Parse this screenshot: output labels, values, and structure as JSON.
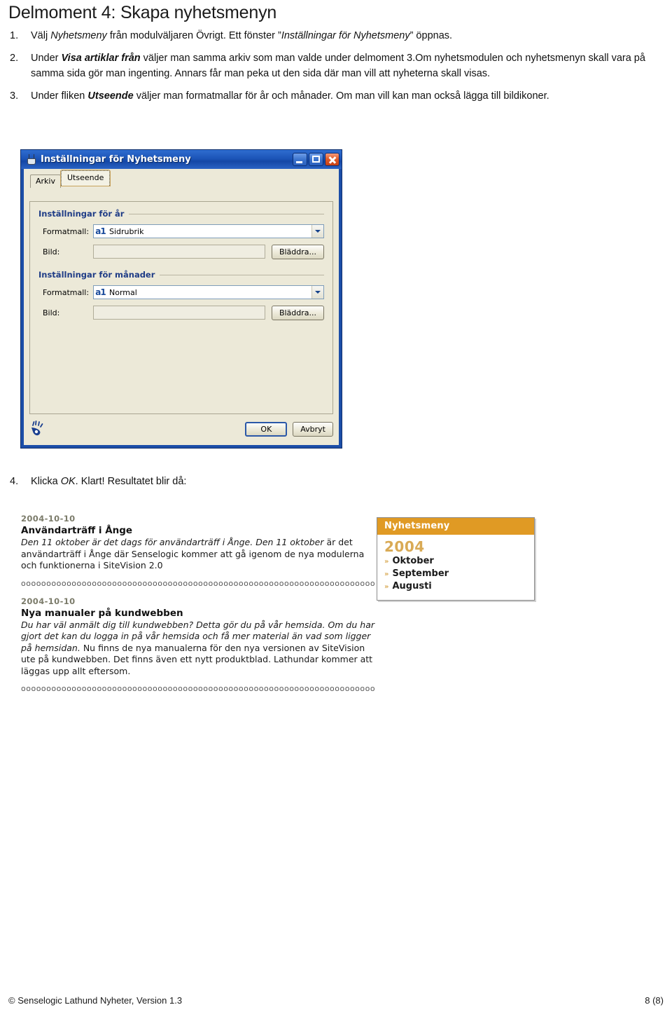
{
  "document": {
    "title": "Delmoment 4: Skapa nyhetsmenyn",
    "steps": [
      {
        "num": "1.",
        "parts": [
          {
            "t": "Välj ",
            "style": "normal"
          },
          {
            "t": "Nyhetsmeny",
            "style": "italic"
          },
          {
            "t": " från modulväljaren Övrigt. Ett fönster ”",
            "style": "normal"
          },
          {
            "t": "Inställningar för Nyhetsmeny",
            "style": "italic"
          },
          {
            "t": "” öppnas.",
            "style": "normal"
          }
        ]
      },
      {
        "num": "2.",
        "parts": [
          {
            "t": "Under ",
            "style": "normal"
          },
          {
            "t": "Visa artiklar från",
            "style": "italic-bold"
          },
          {
            "t": " väljer man samma arkiv som man valde under delmoment 3.Om nyhetsmodulen och nyhetsmenyn skall vara på samma sida gör man ingenting. Annars får man peka ut den sida där man vill att nyheterna skall visas.",
            "style": "normal"
          }
        ]
      },
      {
        "num": "3.",
        "parts": [
          {
            "t": "Under fliken ",
            "style": "normal"
          },
          {
            "t": "Utseende",
            "style": "italic-bold"
          },
          {
            "t": " väljer man formatmallar för år och månader. Om man vill kan man också lägga till bildikoner.",
            "style": "normal"
          }
        ]
      },
      {
        "num": "4.",
        "parts": [
          {
            "t": "Klicka ",
            "style": "normal"
          },
          {
            "t": "OK",
            "style": "italic"
          },
          {
            "t": ". Klart! Resultatet blir då:",
            "style": "normal"
          }
        ]
      }
    ]
  },
  "dialog": {
    "title": "Inställningar för Nyhetsmeny",
    "app_icon": "coffee-cup-icon",
    "window_buttons": {
      "minimize": "minimize-icon",
      "maximize": "maximize-icon",
      "close": "close-icon"
    },
    "tabs": [
      {
        "label": "Arkiv",
        "active": false
      },
      {
        "label": "Utseende",
        "active": true
      }
    ],
    "groups": [
      {
        "title": "Inställningar för år",
        "formatmall_label": "Formatmall:",
        "formatmall_value": "Sidrubrik",
        "formatmall_icon": "a1-style-icon",
        "bild_label": "Bild:",
        "bild_value": "",
        "browse_label": "Bläddra..."
      },
      {
        "title": "Inställningar för månader",
        "formatmall_label": "Formatmall:",
        "formatmall_value": "Normal",
        "formatmall_icon": "a1-style-icon",
        "bild_label": "Bild:",
        "bild_value": "",
        "browse_label": "Bläddra..."
      }
    ],
    "footer": {
      "logo": "senselogic-hand-logo",
      "ok_label": "OK",
      "cancel_label": "Avbryt"
    }
  },
  "result": {
    "news": [
      {
        "date": "2004-10-10",
        "heading": "Användarträff i Ånge",
        "lead": "Den 11 oktober är det dags för användarträff i Ånge. Den 11 oktober ",
        "body": "är det användarträff i Ånge där Senselogic kommer att gå igenom de nya modulerna och funktionerna i SiteVision 2.0"
      },
      {
        "date": "2004-10-10",
        "heading": "Nya manualer på kundwebben",
        "lead": "Du har väl anmält dig till kundwebben? Detta gör du på vår hemsida. Om du har gjort det kan du logga in på vår hemsida och få mer material än vad som ligger på hemsidan.",
        "body": " Nu finns de nya manualerna för den nya versionen av SiteVision ute på kundwebben. Det finns även ett nytt produktblad. Lathundar kommer att läggas upp allt eftersom."
      }
    ],
    "separator": "ooooooooooooooooooooooooooooooooooooooooooooooooooooooooooooooooooooooooooooooooooo",
    "menu": {
      "header": "Nyhetsmeny",
      "year": "2004",
      "items": [
        "Oktober",
        "September",
        "Augusti"
      ],
      "chevron": "»",
      "header_color": "#e09a24",
      "year_color": "#d9aa55"
    }
  },
  "page_footer": {
    "copyright": "© Senselogic Lathund Nyheter, Version 1.3",
    "page_number": "8 (8)"
  }
}
